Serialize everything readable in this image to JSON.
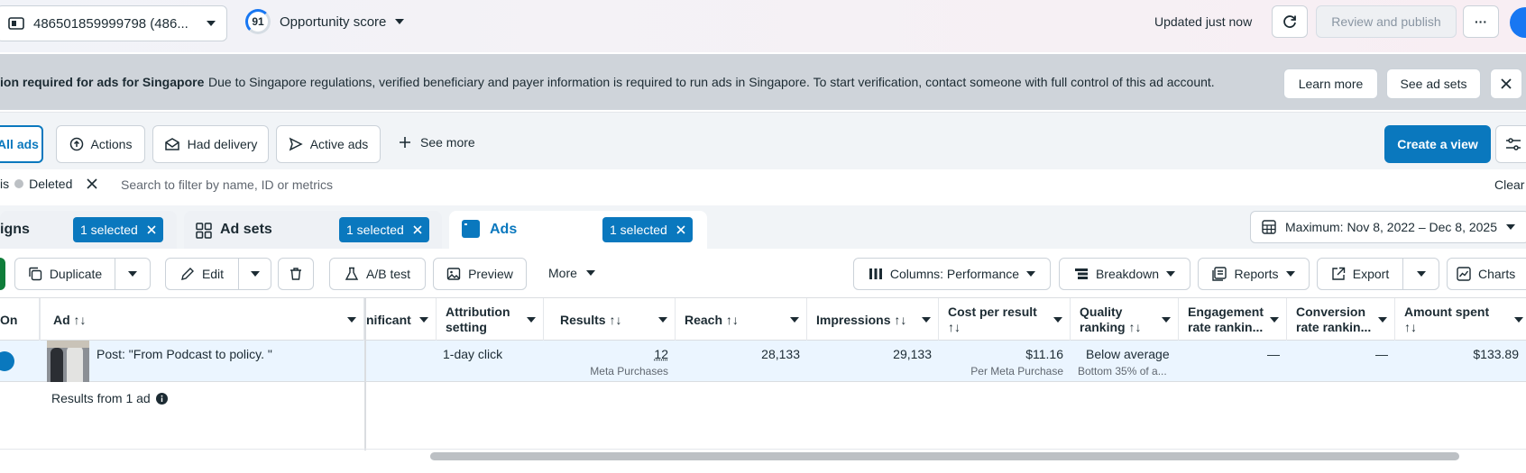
{
  "header": {
    "account": "486501859999798 (486...",
    "opportunity_score": "91",
    "opportunity_label": "Opportunity score",
    "updated": "Updated just now",
    "review_publish": "Review and publish",
    "more": "···"
  },
  "banner": {
    "title": "ion required for ads for Singapore",
    "text": "Due to Singapore regulations, verified beneficiary and payer information is required to run ads in Singapore. To start verification, contact someone with full control of this ad account.",
    "learn_more": "Learn more",
    "see_ad_sets": "See ad sets"
  },
  "filters": {
    "all_ads": "All ads",
    "actions": "Actions",
    "had_delivery": "Had delivery",
    "active_ads": "Active ads",
    "see_more": "See more",
    "create_view": "Create a view"
  },
  "search": {
    "chip_prefix": "is",
    "chip": "Deleted",
    "placeholder": "Search to filter by name, ID or metrics",
    "clear": "Clear"
  },
  "levels": {
    "campaigns_label": "igns",
    "campaigns_selected": "1 selected",
    "adsets_label": "Ad sets",
    "adsets_selected": "1 selected",
    "ads_label": "Ads",
    "ads_selected": "1 selected",
    "date_range": "Maximum: Nov 8, 2022 – Dec 8, 2025"
  },
  "toolbar": {
    "duplicate": "Duplicate",
    "edit": "Edit",
    "ab_test": "A/B test",
    "preview": "Preview",
    "more": "More",
    "columns": "Columns: Performance",
    "breakdown": "Breakdown",
    "reports": "Reports",
    "export": "Export",
    "charts": "Charts"
  },
  "table": {
    "headers": {
      "on": "On",
      "ad": "Ad ↑↓",
      "significant": "nificant",
      "attribution": "Attribution setting",
      "results": "Results ↑↓",
      "reach": "Reach ↑↓",
      "impressions": "Impressions ↑↓",
      "cost_per_result": "Cost per result ↑↓",
      "quality": "Quality ranking ↑↓",
      "engagement": "Engagement rate rankin...",
      "conversion": "Conversion rate rankin...",
      "amount_spent": "Amount spent ↑↓"
    },
    "row": {
      "name": "Post: \"From Podcast to policy. \"",
      "attribution": "1-day click",
      "results": "12",
      "results_sub": "Meta Purchases",
      "reach": "28,133",
      "impressions": "29,133",
      "cost_per_result": "$11.16",
      "cost_sub": "Per Meta Purchase",
      "quality": "Below average",
      "quality_sub": "Bottom 35% of a...",
      "engagement": "—",
      "conversion": "—",
      "amount_spent": "$133.89"
    },
    "summary": "Results from 1 ad"
  },
  "colors": {
    "primary": "#0a78be",
    "banner_bg": "#cfd4da",
    "row_selected": "#ebf5ff"
  }
}
